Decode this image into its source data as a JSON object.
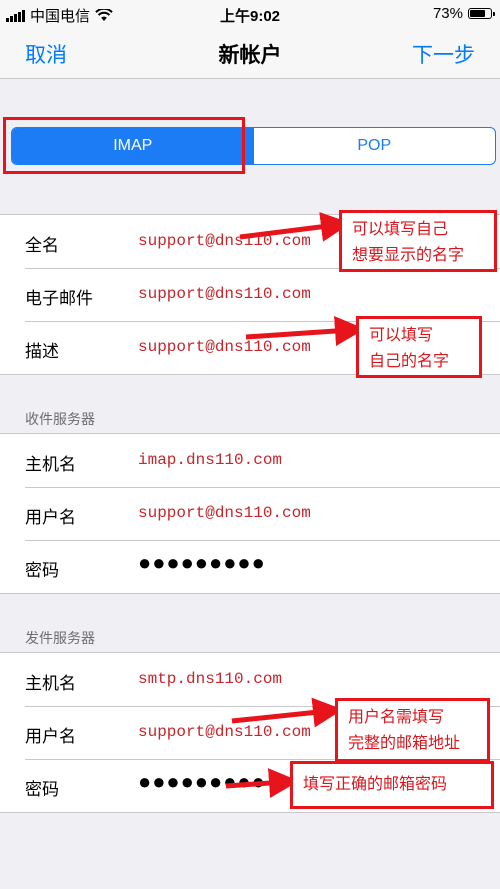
{
  "status": {
    "carrier": "中国电信",
    "time": "上午9:02",
    "battery": "73%",
    "battery_level": 0.73
  },
  "nav": {
    "cancel": "取消",
    "title": "新帐户",
    "next": "下一步"
  },
  "protocol": {
    "imap": "IMAP",
    "pop": "POP",
    "selected": "IMAP"
  },
  "account": {
    "name_label": "全名",
    "name_value": "support@dns110.com",
    "email_label": "电子邮件",
    "email_value": "support@dns110.com",
    "desc_label": "描述",
    "desc_value": "support@dns110.com"
  },
  "incoming": {
    "header": "收件服务器",
    "host_label": "主机名",
    "host_value": "imap.dns110.com",
    "user_label": "用户名",
    "user_value": "support@dns110.com",
    "pass_label": "密码",
    "pass_value": "●●●●●●●●●"
  },
  "outgoing": {
    "header": "发件服务器",
    "host_label": "主机名",
    "host_value": "smtp.dns110.com",
    "user_label": "用户名",
    "user_value": "support@dns110.com",
    "pass_label": "密码",
    "pass_value": "●●●●●●●●●"
  },
  "annotations": {
    "fullname_line1": "可以填写自己",
    "fullname_line2": "想要显示的名字",
    "desc_line1": "可以填写",
    "desc_line2": "自己的名字",
    "smtp_user_line1": "用户名需填写",
    "smtp_user_line2": "完整的邮箱地址",
    "smtp_pass": "填写正确的邮箱密码"
  },
  "colors": {
    "ios_blue": "#007aff",
    "segment_blue": "#1b7cf5",
    "annotation_red": "#e8141b"
  }
}
